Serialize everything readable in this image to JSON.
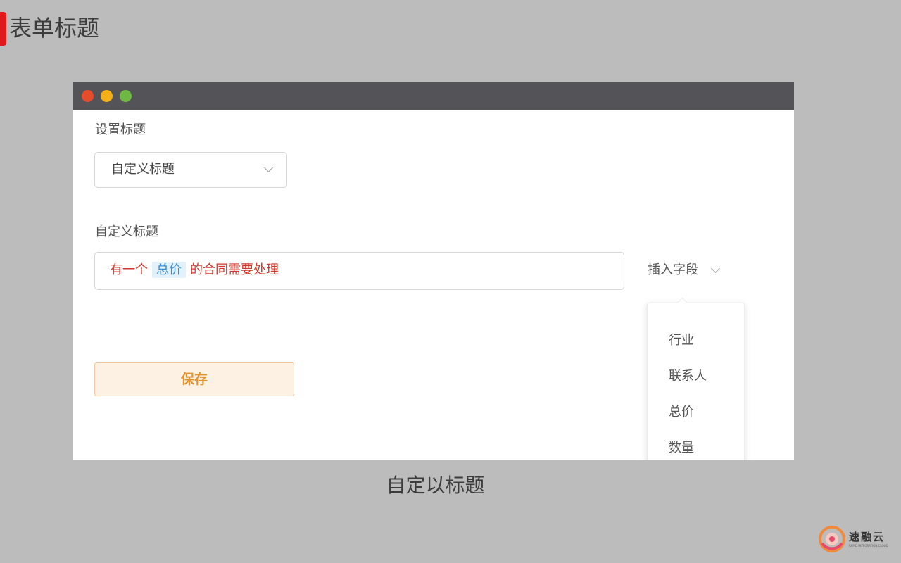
{
  "slide": {
    "title": "表单标题",
    "caption": "自定以标题"
  },
  "form": {
    "title_setting_label": "设置标题",
    "title_select_value": "自定义标题",
    "custom_title_label": "自定义标题",
    "custom_title_parts": {
      "prefix": "有一个",
      "field_tag": "总价",
      "suffix": "的合同需要处理"
    },
    "insert_field_label": "插入字段",
    "save_label": "保存"
  },
  "field_dropdown": {
    "items": [
      "行业",
      "联系人",
      "总价",
      "数量"
    ]
  },
  "logo": {
    "text": "速融云",
    "subtext": "RAPID INTEGRATION CLOUD"
  },
  "colors": {
    "accent": "#e01a1a",
    "titlebar": "#545358",
    "field_text": "#d2352b",
    "field_tag": "#3f8fd0",
    "save_button_text": "#e3922f"
  }
}
